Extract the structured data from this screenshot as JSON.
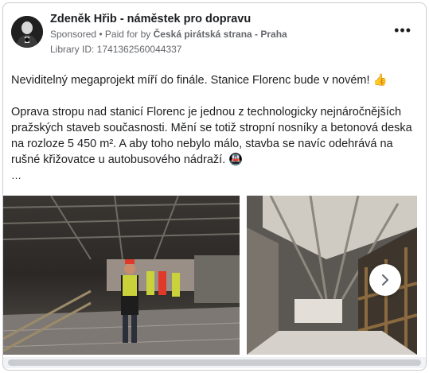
{
  "post": {
    "author": "Zdeněk Hřib - náměstek pro dopravu",
    "sponsored": "Sponsored",
    "separator": " • ",
    "paid_for_prefix": "Paid for by ",
    "payer": "Česká pirátská strana - Praha",
    "library_id": "Library ID: 1741362560044337",
    "more_label": "•••",
    "paragraph1": "Neviditelný megaprojekt míří do finále. Stanice Florenc bude v novém! 👍",
    "paragraph2": "Oprava stropu nad stanicí Florenc je jednou z technologicky nejnáročnějších pražských staveb současnosti. Mění se totiž stropní nosníky a betonová deska na rozloze 5 450 m². A aby toho nebylo málo, stavba se navíc odehrává na rušné křižovatce u autobusového nádraží. 🚇",
    "ellipsis": "…"
  },
  "carousel": {
    "next_icon": "chevron-right-icon"
  },
  "colors": {
    "text_primary": "#1c1e21",
    "text_secondary": "#65676b",
    "border": "#c9ccd1"
  }
}
